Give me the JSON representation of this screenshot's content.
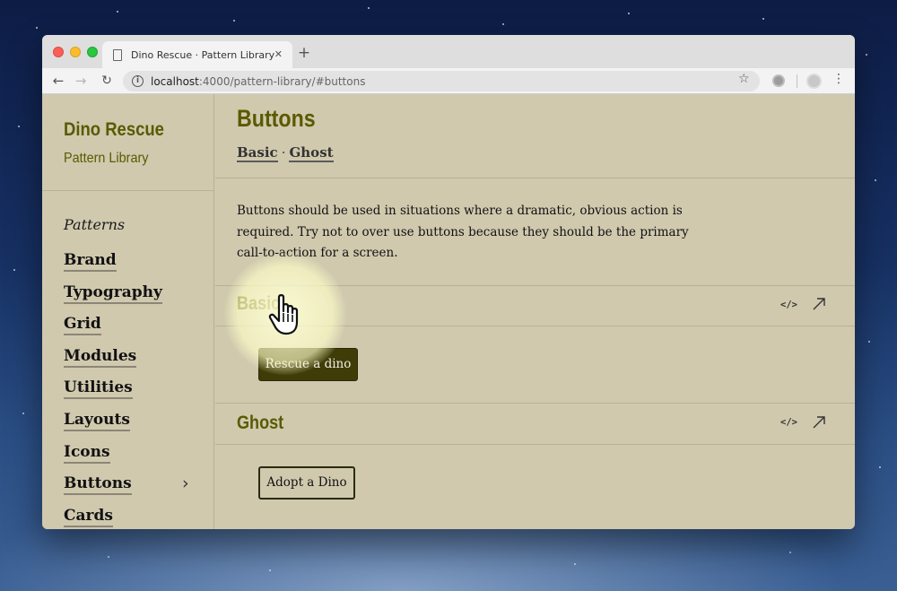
{
  "browser": {
    "tab_title": "Dino Rescue · Pattern Library",
    "tab_close": "✕",
    "new_tab": "+",
    "url_host": "localhost",
    "url_path": ":4000/pattern-library/#buttons",
    "back": "←",
    "forward": "→",
    "reload": "↻",
    "bookmark": "☆",
    "menu": "⋮"
  },
  "sidebar": {
    "brand_title": "Dino Rescue",
    "brand_subtitle": "Pattern Library",
    "section_label": "Patterns",
    "items": [
      {
        "label": "Brand"
      },
      {
        "label": "Typography"
      },
      {
        "label": "Grid"
      },
      {
        "label": "Modules"
      },
      {
        "label": "Utilities"
      },
      {
        "label": "Layouts"
      },
      {
        "label": "Icons"
      },
      {
        "label": "Buttons"
      },
      {
        "label": "Cards"
      }
    ],
    "active_item": "Buttons",
    "active_chevron": "›"
  },
  "main": {
    "title": "Buttons",
    "anchors": [
      {
        "label": "Basic"
      },
      {
        "label": "Ghost"
      }
    ],
    "anchor_separator": "·",
    "intro": "Buttons should be used in situations where a dramatic, obvious action is required. Try not to over use buttons because they should be the primary call-to-action for a screen.",
    "sections": [
      {
        "title": "Basic",
        "code_icon": "</>",
        "button_label": "Rescue a dino"
      },
      {
        "title": "Ghost",
        "code_icon": "</>",
        "button_label": "Adopt a Dino"
      }
    ]
  },
  "colors": {
    "page_bg": "#d0c9ae",
    "accent_olive": "#5a5a00",
    "solid_button": "#3f3c08",
    "text": "#111111"
  },
  "icons": [
    "page-icon",
    "info-icon",
    "bookmark-star-icon",
    "extension-icon",
    "profile-icon",
    "menu-icon",
    "chevron-right-icon",
    "code-icon",
    "open-external-icon",
    "hand-pointer-icon"
  ]
}
